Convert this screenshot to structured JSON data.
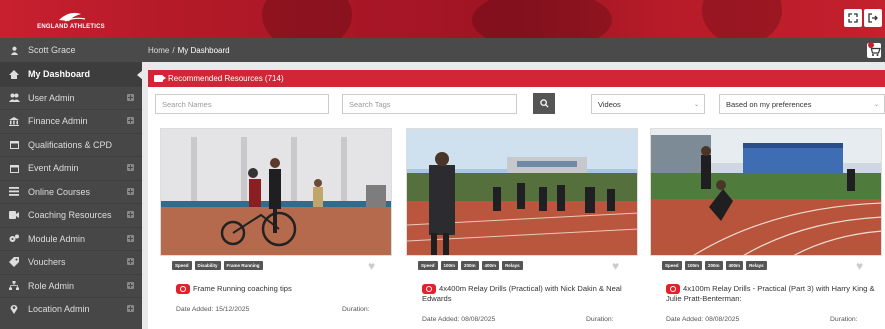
{
  "brand": {
    "name": "ENGLAND ATHLETICS"
  },
  "sidebar": {
    "user": "Scott Grace",
    "items": [
      {
        "label": "My Dashboard",
        "icon": "home-icon",
        "active": true,
        "expandable": false
      },
      {
        "label": "User Admin",
        "icon": "users-icon",
        "active": false,
        "expandable": true
      },
      {
        "label": "Finance Admin",
        "icon": "bank-icon",
        "active": false,
        "expandable": true
      },
      {
        "label": "Qualifications & CPD",
        "icon": "calendar-icon",
        "active": false,
        "expandable": false
      },
      {
        "label": "Event Admin",
        "icon": "calendar-icon",
        "active": false,
        "expandable": true
      },
      {
        "label": "Online Courses",
        "icon": "list-icon",
        "active": false,
        "expandable": true
      },
      {
        "label": "Coaching Resources",
        "icon": "video-icon",
        "active": false,
        "expandable": true
      },
      {
        "label": "Module Admin",
        "icon": "cogs-icon",
        "active": false,
        "expandable": true
      },
      {
        "label": "Vouchers",
        "icon": "tag-icon",
        "active": false,
        "expandable": true
      },
      {
        "label": "Role Admin",
        "icon": "sitemap-icon",
        "active": false,
        "expandable": true
      },
      {
        "label": "Location Admin",
        "icon": "map-marker-icon",
        "active": false,
        "expandable": true
      }
    ]
  },
  "breadcrumb": {
    "home": "Home",
    "separator": "/",
    "current": "My Dashboard"
  },
  "panel": {
    "title": "Recommended Resources (714)",
    "search_names_placeholder": "Search Names",
    "search_tags_placeholder": "Search Tags",
    "type_select": "Videos",
    "sort_select": "Based on my preferences"
  },
  "cards": [
    {
      "tags": [
        "Speed",
        "Disability",
        "Frame Running"
      ],
      "title": "Frame Running coaching tips",
      "date_label": "Date Added: 15/12/2025",
      "duration_label": "Duration:"
    },
    {
      "tags": [
        "Speed",
        "100m",
        "200m",
        "400m",
        "Relays"
      ],
      "title": "4x400m Relay Drills (Practical) with Nick Dakin & Neal Edwards",
      "date_label": "Date Added: 08/08/2025",
      "duration_label": "Duration:"
    },
    {
      "tags": [
        "Speed",
        "100m",
        "200m",
        "400m",
        "Relays"
      ],
      "title": "4x100m Relay Drills - Practical (Part 3) with Harry King & Julie Pratt-Benterman:",
      "date_label": "Date Added: 08/08/2025",
      "duration_label": "Duration:"
    }
  ],
  "colors": {
    "accent": "#d22636",
    "sidebar": "#474747",
    "youtube": "#e4202c"
  }
}
